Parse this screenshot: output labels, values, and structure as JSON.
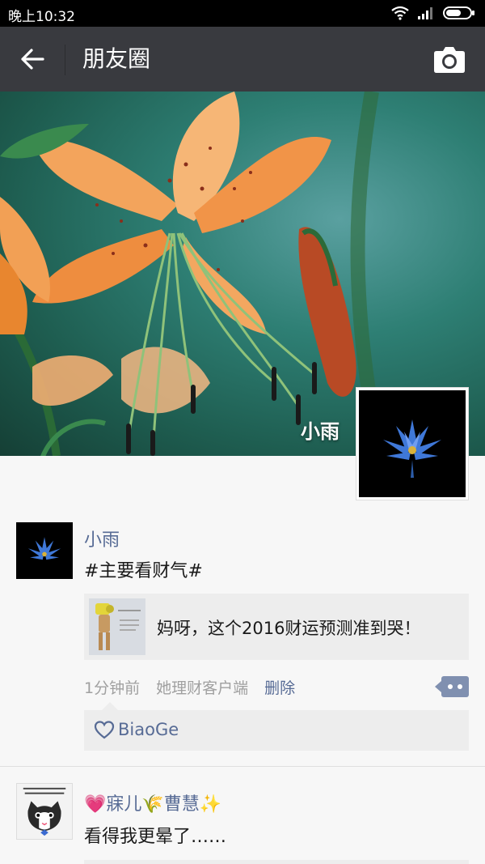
{
  "status_bar": {
    "time": "晚上10:32"
  },
  "nav": {
    "title": "朋友圈"
  },
  "cover": {
    "user_name": "小雨"
  },
  "post1": {
    "author": "小雨",
    "text": "#主要看财气#",
    "link_text": "妈呀，这个2016财运预测准到哭！",
    "time": "1分钟前",
    "source": "她理财客户端",
    "delete_label": "删除",
    "liker": "BiaoGe"
  },
  "post2": {
    "author": "💗寐儿🌾曹慧✨",
    "text": "看得我更晕了……"
  },
  "colors": {
    "nav_bg": "#393a3f",
    "link_blue": "#576b95",
    "gray_text": "#a0a0a0",
    "card_bg": "#ededed"
  }
}
